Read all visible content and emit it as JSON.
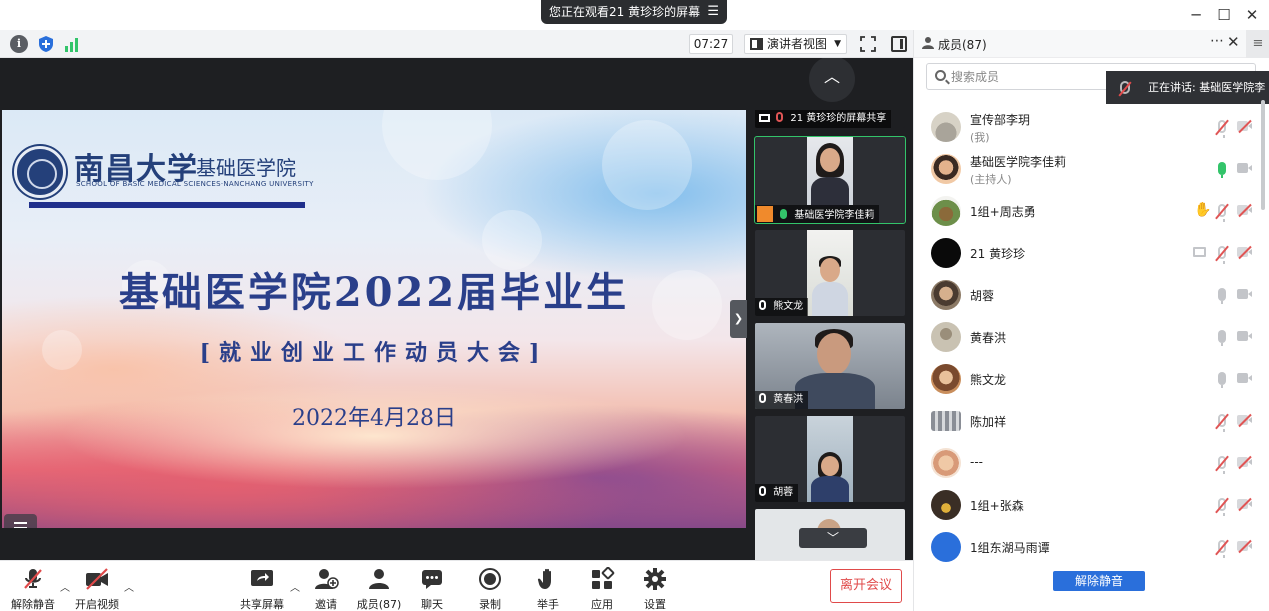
{
  "titlebar": {
    "share_banner": "您正在观看21 黄珍珍的屏幕"
  },
  "video_toolbar": {
    "timer": "07:27",
    "view_mode": "演讲者视图"
  },
  "slide": {
    "university_name": "南昌大学",
    "college_name": "基础医学院",
    "college_english": "SCHOOL OF BASIC MEDICAL SCIENCES·NANCHANG UNIVERSITY",
    "title": "基础医学院2022届毕业生",
    "subtitle": "[就业创业工作动员大会]",
    "date": "2022年4月28日"
  },
  "filmstrip": {
    "tiles": [
      {
        "name": "21 黄珍珍的屏幕共享"
      },
      {
        "name": "基础医学院李佳莉"
      },
      {
        "name": "熊文龙"
      },
      {
        "name": "黄春洪"
      },
      {
        "name": "胡蓉"
      }
    ]
  },
  "bottom_bar": {
    "unmute_label": "解除静音",
    "video_label": "开启视频",
    "share_label": "共享屏幕",
    "invite_label": "邀请",
    "members_label": "成员(87)",
    "chat_label": "聊天",
    "record_label": "录制",
    "raise_hand_label": "举手",
    "apps_label": "应用",
    "settings_label": "设置",
    "leave_label": "离开会议"
  },
  "panel": {
    "title": "成员(87)",
    "search_placeholder": "搜索成员",
    "speaking_toast": "正在讲话: 基础医学院李",
    "unmute_all_label": "解除静音",
    "members": [
      {
        "name": "宣传部李玥",
        "role": "(我)"
      },
      {
        "name": "基础医学院李佳莉",
        "role": "(主持人)"
      },
      {
        "name": "1组+周志勇",
        "role": ""
      },
      {
        "name": "21 黄珍珍",
        "role": ""
      },
      {
        "name": "胡蓉",
        "role": ""
      },
      {
        "name": "黄春洪",
        "role": ""
      },
      {
        "name": "熊文龙",
        "role": ""
      },
      {
        "name": "陈加祥",
        "role": ""
      },
      {
        "name": "---",
        "role": ""
      },
      {
        "name": "1组+张森",
        "role": ""
      },
      {
        "name": "1组东湖马雨谭",
        "role": ""
      }
    ]
  },
  "colors": {
    "accent_blue": "#2a6fdb",
    "leave_red": "#e04a4a",
    "speaking_green": "#33c46a",
    "slide_text": "#2a3f8a"
  }
}
